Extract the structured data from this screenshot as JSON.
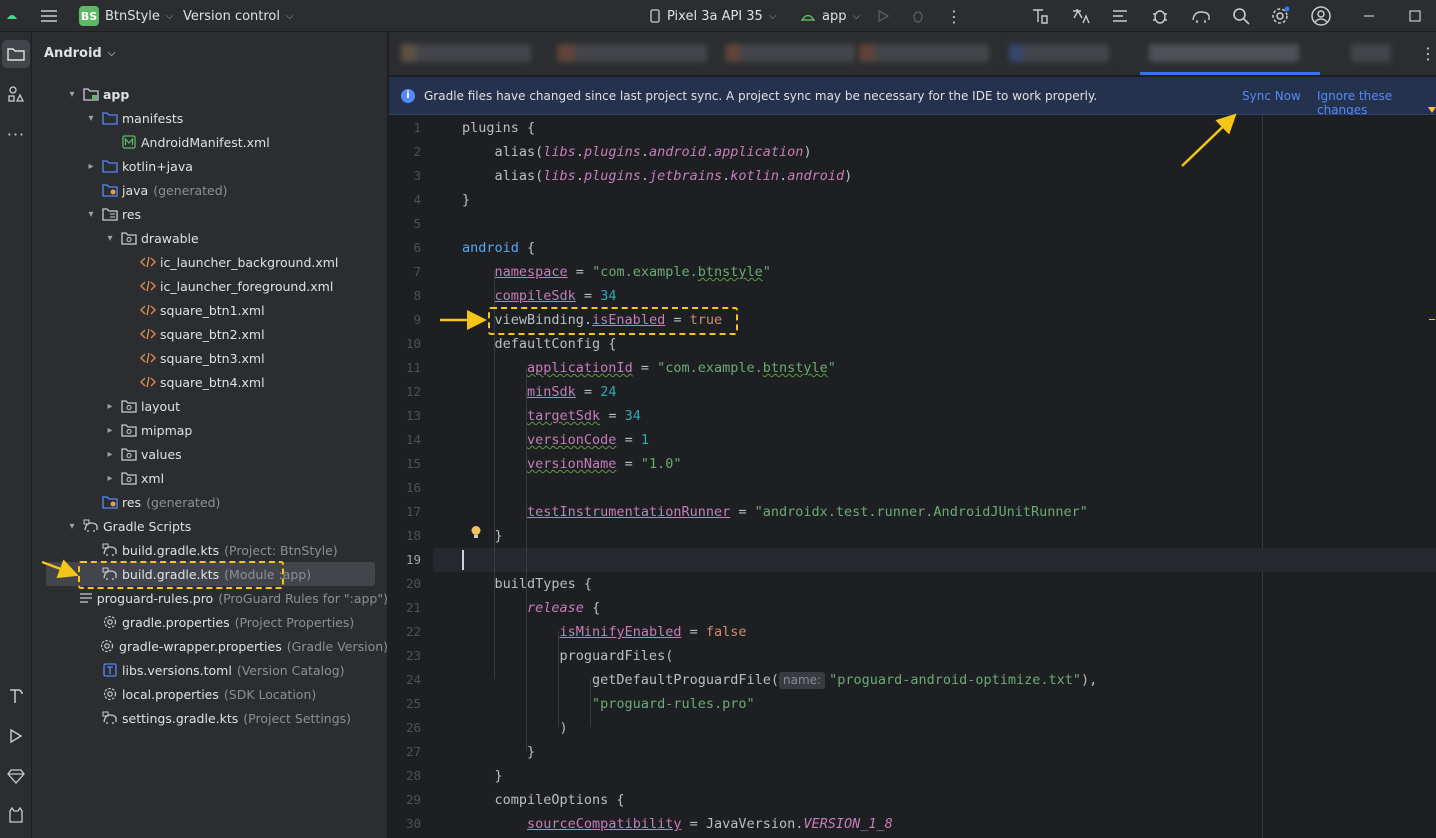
{
  "titlebar": {
    "project_initials": "BS",
    "project_name": "BtnStyle",
    "vcs_label": "Version control",
    "device_label": "Pixel 3a API 35",
    "run_config_label": "app"
  },
  "project_panel": {
    "view_label": "Android",
    "tree": [
      {
        "name": "app",
        "sub": "",
        "icon": "module-folder-icon",
        "twisty": "▾"
      },
      {
        "name": "manifests",
        "sub": "",
        "icon": "folder-icon",
        "twisty": "▾"
      },
      {
        "name": "AndroidManifest.xml",
        "sub": "",
        "icon": "manifest-icon",
        "twisty": ""
      },
      {
        "name": "kotlin+java",
        "sub": "",
        "icon": "folder-icon",
        "twisty": "▸"
      },
      {
        "name": "java",
        "sub": "(generated)",
        "icon": "generated-folder-icon",
        "twisty": ""
      },
      {
        "name": "res",
        "sub": "",
        "icon": "resource-folder-icon",
        "twisty": "▾"
      },
      {
        "name": "drawable",
        "sub": "",
        "icon": "package-folder-icon",
        "twisty": "▾"
      },
      {
        "name": "ic_launcher_background.xml",
        "sub": "",
        "icon": "xml-icon",
        "twisty": ""
      },
      {
        "name": "ic_launcher_foreground.xml",
        "sub": "",
        "icon": "xml-icon",
        "twisty": ""
      },
      {
        "name": "square_btn1.xml",
        "sub": "",
        "icon": "xml-icon",
        "twisty": ""
      },
      {
        "name": "square_btn2.xml",
        "sub": "",
        "icon": "xml-icon",
        "twisty": ""
      },
      {
        "name": "square_btn3.xml",
        "sub": "",
        "icon": "xml-icon",
        "twisty": ""
      },
      {
        "name": "square_btn4.xml",
        "sub": "",
        "icon": "xml-icon",
        "twisty": ""
      },
      {
        "name": "layout",
        "sub": "",
        "icon": "package-folder-icon",
        "twisty": "▸"
      },
      {
        "name": "mipmap",
        "sub": "",
        "icon": "package-folder-icon",
        "twisty": "▸"
      },
      {
        "name": "values",
        "sub": "",
        "icon": "package-folder-icon",
        "twisty": "▸"
      },
      {
        "name": "xml",
        "sub": "",
        "icon": "package-folder-icon",
        "twisty": "▸"
      },
      {
        "name": "res",
        "sub": "(generated)",
        "icon": "generated-folder-icon",
        "twisty": ""
      },
      {
        "name": "Gradle Scripts",
        "sub": "",
        "icon": "gradle-icon",
        "twisty": "▾"
      },
      {
        "name": "build.gradle.kts",
        "sub": "(Project: BtnStyle)",
        "icon": "gradle-icon",
        "twisty": ""
      },
      {
        "name": "build.gradle.kts",
        "sub": "(Module :app)",
        "icon": "gradle-icon",
        "twisty": ""
      },
      {
        "name": "proguard-rules.pro",
        "sub": "(ProGuard Rules for \":app\")",
        "icon": "text-file-icon",
        "twisty": ""
      },
      {
        "name": "gradle.properties",
        "sub": "(Project Properties)",
        "icon": "settings-file-icon",
        "twisty": ""
      },
      {
        "name": "gradle-wrapper.properties",
        "sub": "(Gradle Version)",
        "icon": "settings-file-icon",
        "twisty": ""
      },
      {
        "name": "libs.versions.toml",
        "sub": "(Version Catalog)",
        "icon": "toml-icon",
        "twisty": ""
      },
      {
        "name": "local.properties",
        "sub": "(SDK Location)",
        "icon": "settings-file-icon",
        "twisty": ""
      },
      {
        "name": "settings.gradle.kts",
        "sub": "(Project Settings)",
        "icon": "gradle-icon",
        "twisty": ""
      }
    ]
  },
  "banner": {
    "message": "Gradle files have changed since last project sync. A project sync may be necessary for the IDE to work properly.",
    "sync_now": "Sync Now",
    "ignore": "Ignore these changes"
  },
  "editor": {
    "current_line": 19,
    "first_line_number": 1,
    "lines": [
      "plugins {",
      "    alias(libs.plugins.android.application)",
      "    alias(libs.plugins.jetbrains.kotlin.android)",
      "}",
      "",
      "android {",
      "    namespace = \"com.example.btnstyle\"",
      "    compileSdk = 34",
      "    viewBinding.isEnabled = true",
      "    defaultConfig {",
      "        applicationId = \"com.example.btnstyle\"",
      "        minSdk = 24",
      "        targetSdk = 34",
      "        versionCode = 1",
      "        versionName = \"1.0\"",
      "",
      "        testInstrumentationRunner = \"androidx.test.runner.AndroidJUnitRunner\"",
      "    }",
      "",
      "    buildTypes {",
      "        release {",
      "            isMinifyEnabled = false",
      "            proguardFiles(",
      "                getDefaultProguardFile(name: \"proguard-android-optimize.txt\"),",
      "                \"proguard-rules.pro\"",
      "            )",
      "        }",
      "    }",
      "    compileOptions {",
      "        sourceCompatibility = JavaVersion.VERSION_1_8"
    ]
  },
  "colors": {
    "accent": "#3574f0",
    "link": "#548af7",
    "annotation": "#f5c518",
    "banner_bg": "#25324d"
  }
}
